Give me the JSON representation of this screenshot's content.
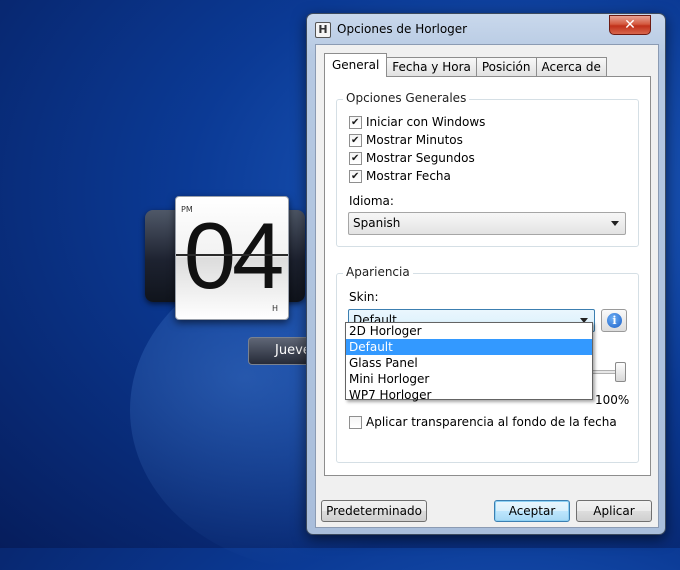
{
  "clock": {
    "ampm": "PM",
    "digits": "04",
    "unit": "H",
    "day": "Jueves"
  },
  "window": {
    "title": "Opciones de Horloger",
    "icon": "H",
    "close_glyph": "✕"
  },
  "tabs": [
    "General",
    "Fecha y Hora",
    "Posición",
    "Acerca de"
  ],
  "general_group": {
    "title": "Opciones Generales",
    "checkboxes": [
      {
        "label": "Iniciar con Windows",
        "checked": true
      },
      {
        "label": "Mostrar Minutos",
        "checked": true
      },
      {
        "label": "Mostrar Segundos",
        "checked": true
      },
      {
        "label": "Mostrar Fecha",
        "checked": true
      }
    ],
    "language_label": "Idioma:",
    "language_value": "Spanish"
  },
  "appearance_group": {
    "title": "Apariencia",
    "skin_label": "Skin:",
    "skin_value": "Default",
    "skin_options": [
      "2D Horloger",
      "Default",
      "Glass Panel",
      "Mini Horloger",
      "WP7 Horloger"
    ],
    "selected_option_index": 1,
    "opacity_label": "100%",
    "opacity_level": 1.0,
    "date_transparency_label": "Aplicar transparencia al fondo de la fecha",
    "date_transparency_checked": false
  },
  "buttons": {
    "defaults": "Predeterminado",
    "ok": "Aceptar",
    "apply": "Aplicar"
  }
}
